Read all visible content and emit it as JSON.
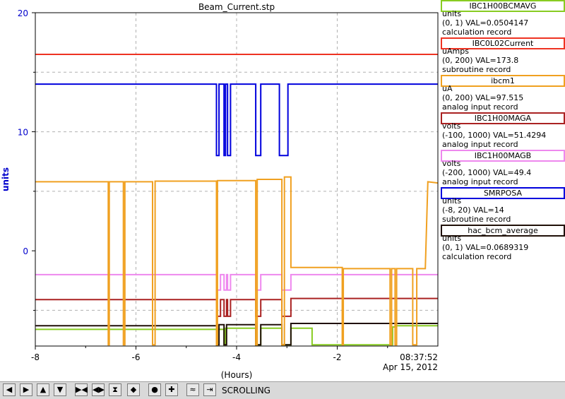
{
  "chart_data": {
    "type": "line",
    "title": "Beam_Current.stp",
    "xlabel": "(Hours)",
    "ylabel": "units",
    "xlim": [
      -8,
      0
    ],
    "ylim": [
      -8,
      20
    ],
    "x_ticks": [
      "-8",
      "-6",
      "-4",
      "-2"
    ],
    "y_ticks": [
      "0",
      "10",
      "20"
    ],
    "x_tick_values": [
      -8,
      -6,
      -4,
      -2
    ],
    "y_tick_values": [
      0,
      10,
      20
    ],
    "grid": true,
    "end_time": "08:37:52",
    "end_date": "Apr 15, 2012",
    "series": [
      {
        "name": "IBC1H00BCMAVG",
        "color": "#88cc22",
        "x": [
          -8,
          -4.4,
          -4.4,
          -4.38,
          -4.38,
          -4.25,
          -4.25,
          -4.22,
          -4.22,
          -3.62,
          -3.62,
          -3.52,
          -3.52,
          -3.1,
          -3.1,
          -2.92,
          -2.92,
          -2.5,
          -2.5,
          -0.9,
          -0.9,
          -0.85,
          -0.85,
          -0.3,
          -0.3,
          0
        ],
        "y": [
          -6.6,
          -6.6,
          -7.9,
          -7.9,
          -6.6,
          -6.6,
          -7.9,
          -7.9,
          -6.5,
          -6.5,
          -7.9,
          -7.9,
          -6.5,
          -6.5,
          -7.9,
          -7.9,
          -6.5,
          -6.5,
          -7.9,
          -7.9,
          -6.4,
          -6.4,
          -6.3,
          -6.3,
          -6.3,
          -6.3
        ]
      },
      {
        "name": "IBC0L02Current",
        "color": "#ee3322",
        "x": [
          -8,
          0
        ],
        "y": [
          16.5,
          16.5
        ]
      },
      {
        "name": "ibcm1",
        "color": "#f0a020",
        "x": [
          -8,
          -6.55,
          -6.55,
          -6.53,
          -6.53,
          -6.25,
          -6.25,
          -6.22,
          -6.22,
          -5.67,
          -5.67,
          -5.62,
          -5.62,
          -4.4,
          -4.4,
          -4.38,
          -4.38,
          -3.62,
          -3.62,
          -3.59,
          -3.59,
          -3.1,
          -3.1,
          -3.05,
          -3.05,
          -2.92,
          -2.92,
          -2.6,
          -2.6,
          -1.9,
          -1.9,
          -1.88,
          -1.88,
          -0.95,
          -0.95,
          -0.92,
          -0.92,
          -0.85,
          -0.85,
          -0.82,
          -0.82,
          -0.5,
          -0.5,
          -0.42,
          -0.42,
          -0.25,
          -0.2,
          0
        ],
        "y": [
          5.8,
          5.8,
          -7.9,
          -7.9,
          5.8,
          5.8,
          -7.9,
          -7.9,
          5.8,
          5.8,
          -7.9,
          -7.9,
          5.85,
          5.85,
          -7.9,
          -7.9,
          5.9,
          5.9,
          -7.9,
          -7.9,
          6.0,
          6.0,
          -7.9,
          -7.9,
          6.2,
          6.2,
          -1.4,
          -1.4,
          -1.4,
          -1.4,
          -7.9,
          -7.9,
          -1.5,
          -1.5,
          -7.9,
          -7.9,
          -1.5,
          -1.5,
          -7.9,
          -7.9,
          -1.5,
          -1.5,
          -7.9,
          -7.9,
          -1.5,
          -1.5,
          5.8,
          5.7
        ]
      },
      {
        "name": "IBC1H00MAGA",
        "color": "#aa2222",
        "x": [
          -8,
          -4.4,
          -4.4,
          -4.32,
          -4.32,
          -4.25,
          -4.25,
          -4.2,
          -4.2,
          -4.18,
          -4.18,
          -4.12,
          -4.12,
          -3.62,
          -3.62,
          -3.52,
          -3.52,
          -3.1,
          -3.1,
          -2.92,
          -2.92,
          0
        ],
        "y": [
          -4.1,
          -4.1,
          -5.5,
          -5.5,
          -4.1,
          -4.1,
          -5.5,
          -5.5,
          -4.1,
          -4.1,
          -5.5,
          -5.5,
          -4.1,
          -4.1,
          -5.5,
          -5.5,
          -4.1,
          -4.1,
          -5.5,
          -5.5,
          -4.0,
          -4.0
        ]
      },
      {
        "name": "IBC1H00MAGB",
        "color": "#ee88ee",
        "x": [
          -8,
          -4.4,
          -4.4,
          -4.32,
          -4.32,
          -4.25,
          -4.25,
          -4.2,
          -4.2,
          -4.18,
          -4.18,
          -4.12,
          -4.12,
          -3.62,
          -3.62,
          -3.52,
          -3.52,
          -3.1,
          -3.1,
          -2.92,
          -2.92,
          0
        ],
        "y": [
          -2.0,
          -2.0,
          -3.3,
          -3.3,
          -2.0,
          -2.0,
          -3.3,
          -3.3,
          -2.0,
          -2.0,
          -3.3,
          -3.3,
          -2.0,
          -2.0,
          -3.3,
          -3.3,
          -2.0,
          -2.0,
          -3.3,
          -3.3,
          -2.0,
          -2.0
        ]
      },
      {
        "name": "SMRPOSA",
        "color": "#0000dd",
        "x": [
          -8,
          -4.4,
          -4.4,
          -4.35,
          -4.35,
          -4.25,
          -4.25,
          -4.22,
          -4.22,
          -4.18,
          -4.18,
          -4.12,
          -4.12,
          -3.62,
          -3.62,
          -3.52,
          -3.52,
          -3.15,
          -3.15,
          -2.98,
          -2.98,
          0
        ],
        "y": [
          14,
          14,
          8,
          8,
          14,
          14,
          8,
          8,
          14,
          14,
          8,
          8,
          14,
          14,
          8,
          8,
          14,
          14,
          8,
          8,
          14,
          14
        ]
      },
      {
        "name": "hac_bcm_average",
        "color": "#201008",
        "x": [
          -8,
          -4.4,
          -4.4,
          -4.35,
          -4.35,
          -4.25,
          -4.25,
          -4.2,
          -4.2,
          -3.62,
          -3.62,
          -3.52,
          -3.52,
          -3.1,
          -3.1,
          -2.92,
          -2.92,
          0
        ],
        "y": [
          -6.3,
          -6.3,
          -7.9,
          -7.9,
          -6.2,
          -6.2,
          -7.9,
          -7.9,
          -6.2,
          -6.2,
          -7.9,
          -7.9,
          -6.2,
          -6.2,
          -7.9,
          -7.9,
          -6.1,
          -6.1
        ]
      }
    ]
  },
  "legend": {
    "items": [
      {
        "name": "IBC1H00BCMAVG",
        "color": "#88cc22",
        "units": "units",
        "range": "(0, 1) VAL=0.0504147",
        "record": "calculation record"
      },
      {
        "name": "IBC0L02Current",
        "color": "#ee3322",
        "units": "uAmps",
        "range": "(0, 200) VAL=173.8",
        "record": "subroutine record"
      },
      {
        "name": "ibcm1",
        "color": "#f0a020",
        "units": "uA",
        "range": "(0, 200) VAL=97.515",
        "record": "analog input record"
      },
      {
        "name": "IBC1H00MAGA",
        "color": "#aa2222",
        "units": "volts",
        "range": "(-100, 1000) VAL=51.4294",
        "record": "analog input record"
      },
      {
        "name": "IBC1H00MAGB",
        "color": "#ee88ee",
        "units": "volts",
        "range": "(-200, 1000) VAL=49.4",
        "record": "analog input record"
      },
      {
        "name": "SMRPOSA",
        "color": "#0000dd",
        "units": "units",
        "range": "(-8, 20) VAL=14",
        "record": "subroutine record"
      },
      {
        "name": "hac_bcm_average",
        "color": "#201008",
        "units": "units",
        "range": "(0, 1) VAL=0.0689319",
        "record": "calculation record"
      }
    ]
  },
  "toolbar": {
    "buttons": [
      {
        "name": "scroll-left",
        "glyph": "◀"
      },
      {
        "name": "scroll-right",
        "glyph": "▶"
      },
      {
        "name": "scroll-up",
        "glyph": "▲"
      },
      {
        "name": "scroll-down",
        "glyph": "▼"
      },
      {
        "name": "zoom-in-x",
        "glyph": "▶◀"
      },
      {
        "name": "zoom-out-x",
        "glyph": "◀▶"
      },
      {
        "name": "zoom-in-y",
        "glyph": "⧗"
      },
      {
        "name": "zoom-out-y",
        "glyph": "◆"
      },
      {
        "name": "stop",
        "glyph": "●"
      },
      {
        "name": "add",
        "glyph": "✚"
      },
      {
        "name": "autoscale",
        "glyph": "≈"
      },
      {
        "name": "go-live",
        "glyph": "⇥"
      }
    ],
    "mode": "SCROLLING"
  }
}
